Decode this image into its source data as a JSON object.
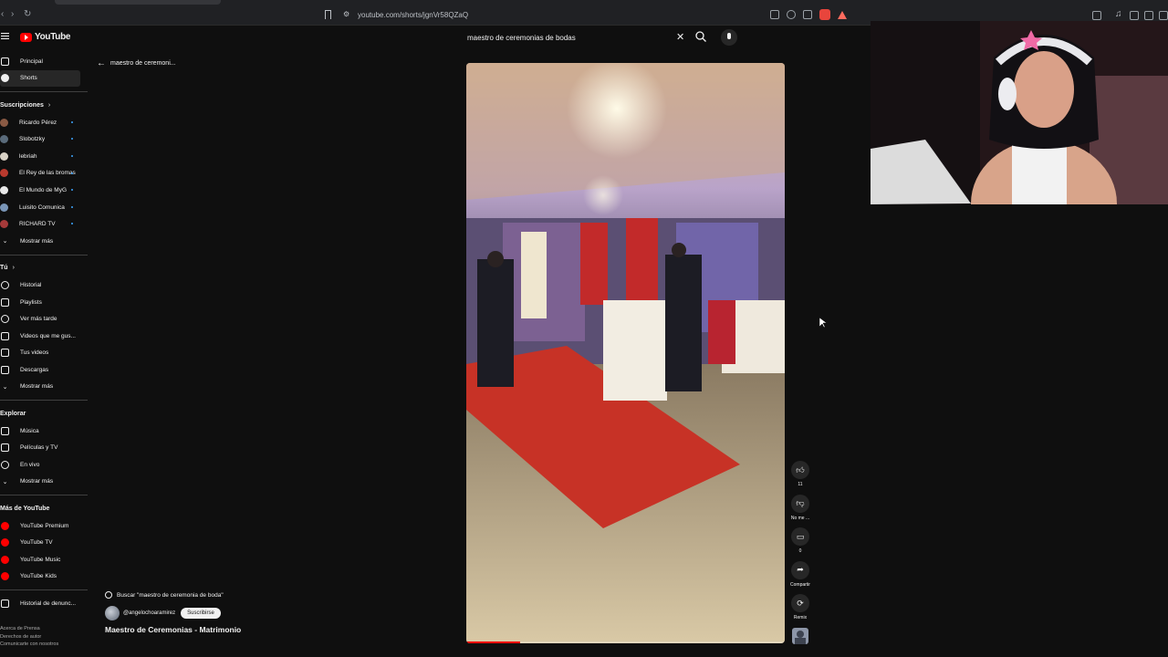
{
  "browser": {
    "url": "youtube.com/shorts/jgnVr58QZaQ"
  },
  "header": {
    "logo_text": "YouTube",
    "search_query": "maestro de ceremonias de bodas"
  },
  "sidebar": {
    "main": [
      {
        "label": "Principal",
        "icon": "home-icon"
      },
      {
        "label": "Shorts",
        "icon": "shorts-icon",
        "active": true
      }
    ],
    "subscriptions_title": "Suscripciones",
    "subscriptions": [
      {
        "label": "Ricardo Pérez",
        "color": "#8a5a44"
      },
      {
        "label": "Slobotzky",
        "color": "#5a6b7b"
      },
      {
        "label": "lebriah",
        "color": "#d9d2c6"
      },
      {
        "label": "El Rey de las bromas",
        "color": "#b93a2e"
      },
      {
        "label": "El Mundo de MyG",
        "color": "#e8e8e8"
      },
      {
        "label": "Luisito Comunica",
        "color": "#7a96b8"
      },
      {
        "label": "RICHARD TV",
        "color": "#a53a3a"
      }
    ],
    "show_more": "Mostrar más",
    "you_title": "Tú",
    "you_items": [
      {
        "label": "Historial",
        "icon": "history-icon"
      },
      {
        "label": "Playlists",
        "icon": "playlists-icon"
      },
      {
        "label": "Ver más tarde",
        "icon": "watch-later-icon"
      },
      {
        "label": "Videos que me gus...",
        "icon": "liked-videos-icon"
      },
      {
        "label": "Tus videos",
        "icon": "your-videos-icon"
      },
      {
        "label": "Descargas",
        "icon": "downloads-icon"
      }
    ],
    "show_more_2": "Mostrar más",
    "explore_title": "Explorar",
    "explore_items": [
      {
        "label": "Música",
        "icon": "music-icon"
      },
      {
        "label": "Películas y TV",
        "icon": "movies-icon"
      },
      {
        "label": "En vivo",
        "icon": "live-icon"
      }
    ],
    "show_more_3": "Mostrar más",
    "more_title": "Más de YouTube",
    "more_items": [
      {
        "label": "YouTube Premium"
      },
      {
        "label": "YouTube TV"
      },
      {
        "label": "YouTube Music"
      },
      {
        "label": "YouTube Kids"
      }
    ],
    "report_history": "Historial de denunc...",
    "footer": [
      "Acerca de  Prensa",
      "Derechos de autor",
      "Comunicarte con nosotros"
    ]
  },
  "shorts": {
    "back_label": "maestro de ceremoni...",
    "search_suggestion": "Buscar \"maestro de ceremonia de boda\"",
    "channel": "@angelochoaramirez",
    "subscribe_label": "Suscribirse",
    "title": "Maestro de Ceremonias - Matrimonio",
    "progress_fraction": 0.17,
    "actions": [
      {
        "name": "like",
        "icon": "thumbs-up-icon",
        "label": "11"
      },
      {
        "name": "dislike",
        "icon": "thumbs-down-icon",
        "label": "No me ..."
      },
      {
        "name": "comments",
        "icon": "comment-icon",
        "label": "0"
      },
      {
        "name": "share",
        "icon": "share-icon",
        "label": "Compartir"
      },
      {
        "name": "remix",
        "icon": "remix-icon",
        "label": "Remix"
      }
    ]
  },
  "colors": {
    "background": "#0f0f0f",
    "brand_red": "#ff0000",
    "accent_blue": "#3ea6ff"
  }
}
